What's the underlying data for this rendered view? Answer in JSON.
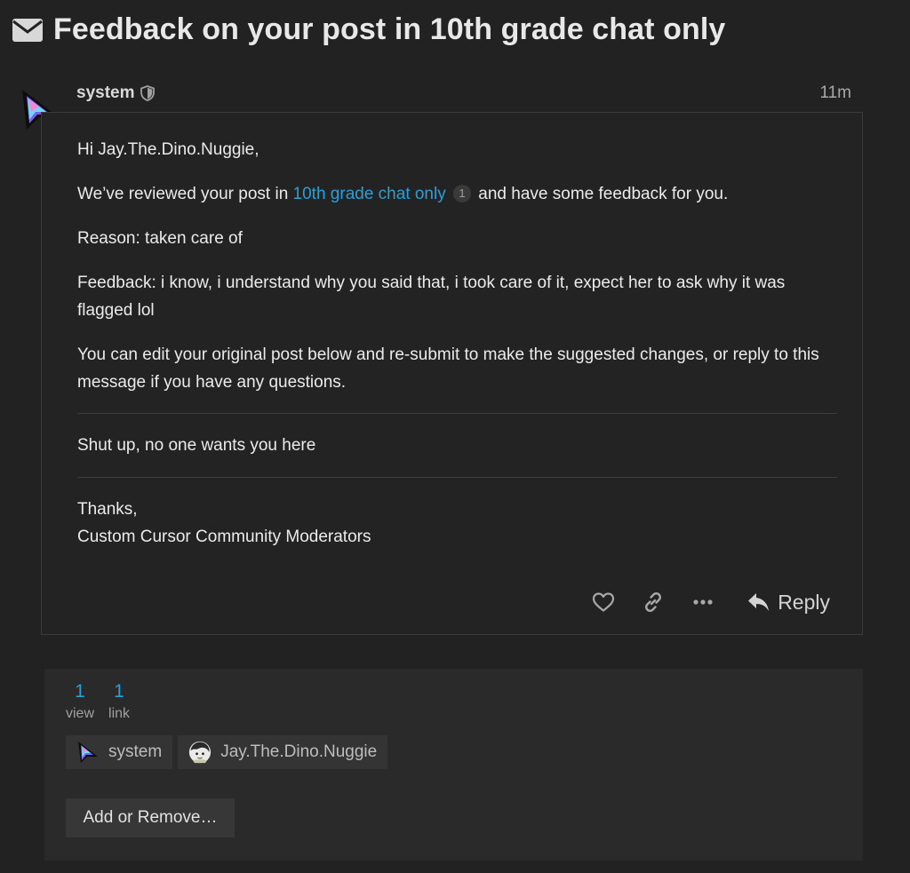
{
  "topic": {
    "title": "Feedback on your post in 10th grade chat only",
    "icon": "envelope-icon"
  },
  "post": {
    "username": "system",
    "badge_icon": "shield-icon",
    "date": "11m",
    "greeting": "Hi Jay.The.Dino.Nuggie,",
    "review_prefix": "We’ve reviewed your post in",
    "review_link": "10th grade chat only",
    "review_link_count": "1",
    "review_suffix": "and have some feedback for you.",
    "reason": "Reason: taken care of",
    "feedback": "Feedback: i know, i understand why you said that, i took care of it, expect her to ask why it was flagged lol",
    "instructions": "You can edit your original post below and re-submit to make the suggested changes, or reply to this message if you have any questions.",
    "quoted_post": "Shut up, no one wants you here",
    "thanks": "Thanks,",
    "signature": "Custom Cursor Community Moderators",
    "actions": {
      "like_icon": "heart-icon",
      "share_icon": "link-icon",
      "more_icon": "ellipsis-icon",
      "reply_icon": "reply-arrow-icon",
      "reply_label": "Reply"
    }
  },
  "topic_map": {
    "stats": [
      {
        "number": "1",
        "label": "view"
      },
      {
        "number": "1",
        "label": "link"
      }
    ],
    "participants": [
      {
        "name": "system"
      },
      {
        "name": "Jay.The.Dino.Nuggie"
      }
    ],
    "add_remove_label": "Add or Remove…"
  },
  "colors": {
    "background": "#222222",
    "link": "#2a9fd8",
    "text": "#ebebeb",
    "muted": "#a8a8a8",
    "chip": "#343434"
  }
}
